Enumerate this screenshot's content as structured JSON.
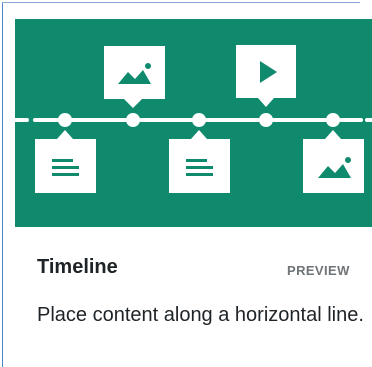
{
  "card": {
    "title": "Timeline",
    "preview_label": "PREVIEW",
    "description": "Place content along a horizontal line."
  },
  "hero_icons": [
    "image-icon",
    "play-icon",
    "text-icon",
    "text-icon",
    "image-icon"
  ],
  "colors": {
    "hero_background": "#0f8a6c",
    "icon_fill": "#ffffff",
    "title_text": "#1e2327",
    "preview_text": "#6f7478"
  }
}
